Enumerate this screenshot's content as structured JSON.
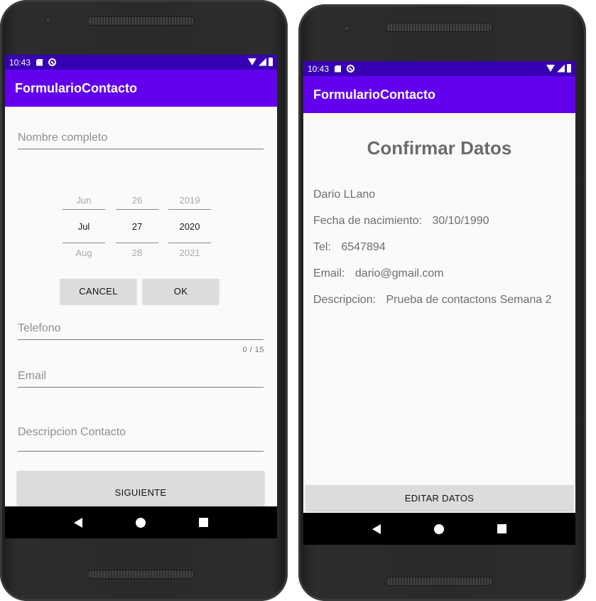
{
  "left_phone": {
    "status": {
      "time": "10:43"
    },
    "app_title": "FormularioContacto",
    "name_field": {
      "placeholder": "Nombre completo",
      "value": ""
    },
    "date_picker": {
      "month": {
        "prev": "Jun",
        "selected": "Jul",
        "next": "Aug"
      },
      "day": {
        "prev": "26",
        "selected": "27",
        "next": "28"
      },
      "year": {
        "prev": "2019",
        "selected": "2020",
        "next": "2021"
      },
      "cancel_label": "CANCEL",
      "ok_label": "OK"
    },
    "phone_field": {
      "placeholder": "Telefono",
      "value": "",
      "counter": "0 / 15"
    },
    "email_field": {
      "placeholder": "Email",
      "value": ""
    },
    "description_field": {
      "placeholder": "Descripcion Contacto",
      "value": ""
    },
    "next_button": "SIGUIENTE"
  },
  "right_phone": {
    "status": {
      "time": "10:43"
    },
    "app_title": "FormularioContacto",
    "heading": "Confirmar Datos",
    "name": "Dario LLano",
    "birth_label": "Fecha de nacimiento:",
    "birth_value": "30/10/1990",
    "phone_label": "Tel:",
    "phone_value": "6547894",
    "email_label": "Email:",
    "email_value": "dario@gmail.com",
    "description_label": "Descripcion:",
    "description_value": "Prueba de contactons Semana 2",
    "edit_button": "EDITAR DATOS"
  },
  "colors": {
    "statusbar": "#3700b3",
    "appbar": "#6200ee",
    "screen_bg": "#fafafa",
    "button_bg": "#dcdcdc"
  }
}
